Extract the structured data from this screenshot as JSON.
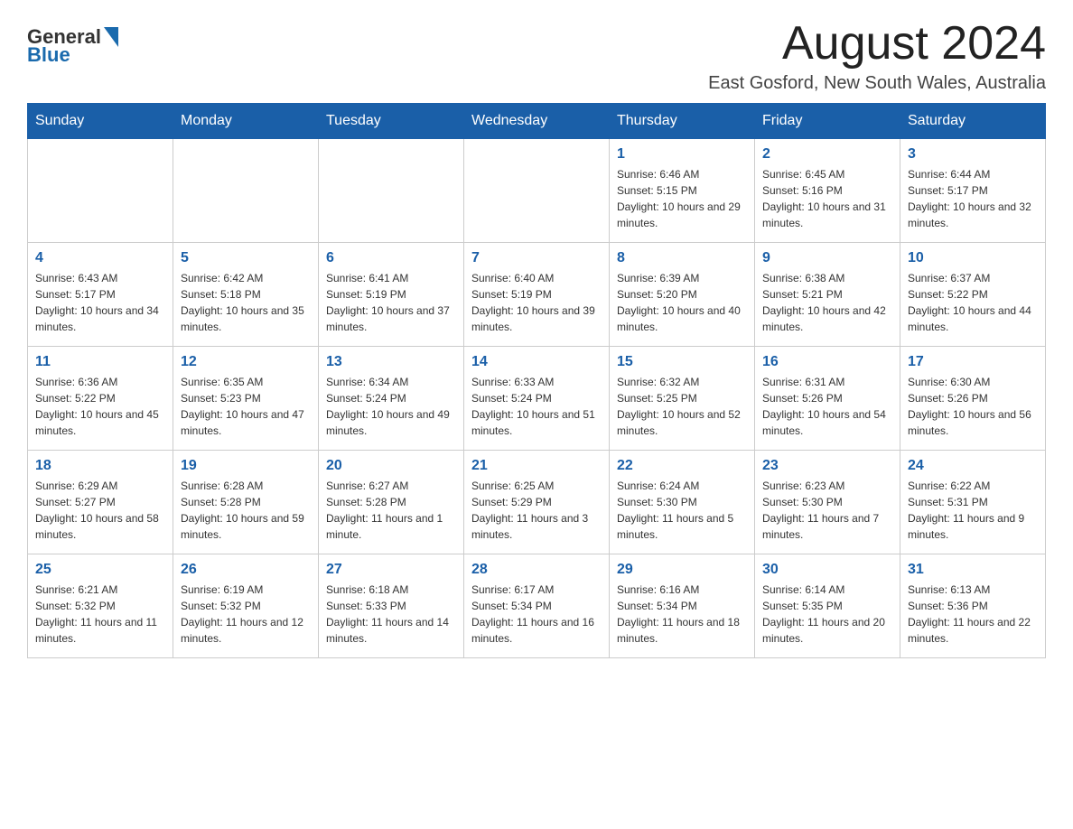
{
  "header": {
    "logo_general": "General",
    "logo_blue": "Blue",
    "month_title": "August 2024",
    "location": "East Gosford, New South Wales, Australia"
  },
  "days_of_week": [
    "Sunday",
    "Monday",
    "Tuesday",
    "Wednesday",
    "Thursday",
    "Friday",
    "Saturday"
  ],
  "weeks": [
    [
      {
        "day": "",
        "info": ""
      },
      {
        "day": "",
        "info": ""
      },
      {
        "day": "",
        "info": ""
      },
      {
        "day": "",
        "info": ""
      },
      {
        "day": "1",
        "info": "Sunrise: 6:46 AM\nSunset: 5:15 PM\nDaylight: 10 hours and 29 minutes."
      },
      {
        "day": "2",
        "info": "Sunrise: 6:45 AM\nSunset: 5:16 PM\nDaylight: 10 hours and 31 minutes."
      },
      {
        "day": "3",
        "info": "Sunrise: 6:44 AM\nSunset: 5:17 PM\nDaylight: 10 hours and 32 minutes."
      }
    ],
    [
      {
        "day": "4",
        "info": "Sunrise: 6:43 AM\nSunset: 5:17 PM\nDaylight: 10 hours and 34 minutes."
      },
      {
        "day": "5",
        "info": "Sunrise: 6:42 AM\nSunset: 5:18 PM\nDaylight: 10 hours and 35 minutes."
      },
      {
        "day": "6",
        "info": "Sunrise: 6:41 AM\nSunset: 5:19 PM\nDaylight: 10 hours and 37 minutes."
      },
      {
        "day": "7",
        "info": "Sunrise: 6:40 AM\nSunset: 5:19 PM\nDaylight: 10 hours and 39 minutes."
      },
      {
        "day": "8",
        "info": "Sunrise: 6:39 AM\nSunset: 5:20 PM\nDaylight: 10 hours and 40 minutes."
      },
      {
        "day": "9",
        "info": "Sunrise: 6:38 AM\nSunset: 5:21 PM\nDaylight: 10 hours and 42 minutes."
      },
      {
        "day": "10",
        "info": "Sunrise: 6:37 AM\nSunset: 5:22 PM\nDaylight: 10 hours and 44 minutes."
      }
    ],
    [
      {
        "day": "11",
        "info": "Sunrise: 6:36 AM\nSunset: 5:22 PM\nDaylight: 10 hours and 45 minutes."
      },
      {
        "day": "12",
        "info": "Sunrise: 6:35 AM\nSunset: 5:23 PM\nDaylight: 10 hours and 47 minutes."
      },
      {
        "day": "13",
        "info": "Sunrise: 6:34 AM\nSunset: 5:24 PM\nDaylight: 10 hours and 49 minutes."
      },
      {
        "day": "14",
        "info": "Sunrise: 6:33 AM\nSunset: 5:24 PM\nDaylight: 10 hours and 51 minutes."
      },
      {
        "day": "15",
        "info": "Sunrise: 6:32 AM\nSunset: 5:25 PM\nDaylight: 10 hours and 52 minutes."
      },
      {
        "day": "16",
        "info": "Sunrise: 6:31 AM\nSunset: 5:26 PM\nDaylight: 10 hours and 54 minutes."
      },
      {
        "day": "17",
        "info": "Sunrise: 6:30 AM\nSunset: 5:26 PM\nDaylight: 10 hours and 56 minutes."
      }
    ],
    [
      {
        "day": "18",
        "info": "Sunrise: 6:29 AM\nSunset: 5:27 PM\nDaylight: 10 hours and 58 minutes."
      },
      {
        "day": "19",
        "info": "Sunrise: 6:28 AM\nSunset: 5:28 PM\nDaylight: 10 hours and 59 minutes."
      },
      {
        "day": "20",
        "info": "Sunrise: 6:27 AM\nSunset: 5:28 PM\nDaylight: 11 hours and 1 minute."
      },
      {
        "day": "21",
        "info": "Sunrise: 6:25 AM\nSunset: 5:29 PM\nDaylight: 11 hours and 3 minutes."
      },
      {
        "day": "22",
        "info": "Sunrise: 6:24 AM\nSunset: 5:30 PM\nDaylight: 11 hours and 5 minutes."
      },
      {
        "day": "23",
        "info": "Sunrise: 6:23 AM\nSunset: 5:30 PM\nDaylight: 11 hours and 7 minutes."
      },
      {
        "day": "24",
        "info": "Sunrise: 6:22 AM\nSunset: 5:31 PM\nDaylight: 11 hours and 9 minutes."
      }
    ],
    [
      {
        "day": "25",
        "info": "Sunrise: 6:21 AM\nSunset: 5:32 PM\nDaylight: 11 hours and 11 minutes."
      },
      {
        "day": "26",
        "info": "Sunrise: 6:19 AM\nSunset: 5:32 PM\nDaylight: 11 hours and 12 minutes."
      },
      {
        "day": "27",
        "info": "Sunrise: 6:18 AM\nSunset: 5:33 PM\nDaylight: 11 hours and 14 minutes."
      },
      {
        "day": "28",
        "info": "Sunrise: 6:17 AM\nSunset: 5:34 PM\nDaylight: 11 hours and 16 minutes."
      },
      {
        "day": "29",
        "info": "Sunrise: 6:16 AM\nSunset: 5:34 PM\nDaylight: 11 hours and 18 minutes."
      },
      {
        "day": "30",
        "info": "Sunrise: 6:14 AM\nSunset: 5:35 PM\nDaylight: 11 hours and 20 minutes."
      },
      {
        "day": "31",
        "info": "Sunrise: 6:13 AM\nSunset: 5:36 PM\nDaylight: 11 hours and 22 minutes."
      }
    ]
  ]
}
